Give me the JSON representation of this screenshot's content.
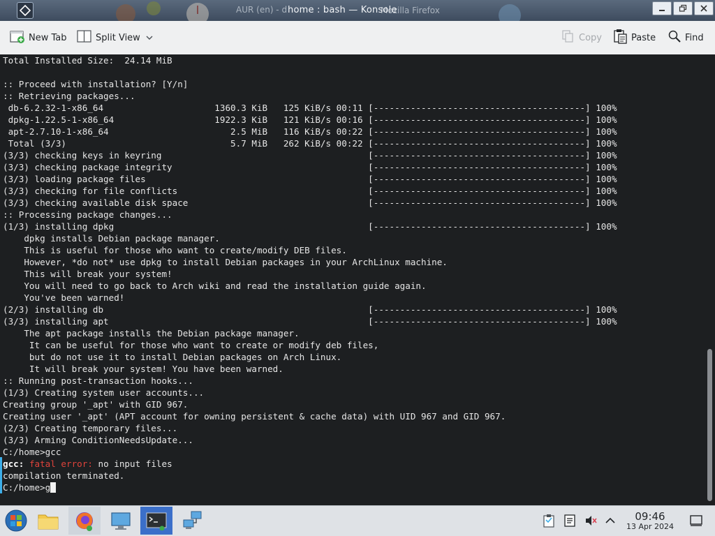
{
  "window": {
    "title": "home : bash — Konsole",
    "behind_title_left": "AUR (en) - d",
    "behind_title_right": "Mozilla Firefox"
  },
  "toolbar": {
    "new_tab": "New Tab",
    "split_view": "Split View",
    "copy": "Copy",
    "paste": "Paste",
    "find": "Find"
  },
  "terminal": {
    "lines": [
      "Total Installed Size:  24.14 MiB",
      "",
      ":: Proceed with installation? [Y/n]",
      ":: Retrieving packages...",
      " db-6.2.32-1-x86_64                     1360.3 KiB   125 KiB/s 00:11 [----------------------------------------] 100%",
      " dpkg-1.22.5-1-x86_64                   1922.3 KiB   121 KiB/s 00:16 [----------------------------------------] 100%",
      " apt-2.7.10-1-x86_64                       2.5 MiB   116 KiB/s 00:22 [----------------------------------------] 100%",
      " Total (3/3)                               5.7 MiB   262 KiB/s 00:22 [----------------------------------------] 100%",
      "(3/3) checking keys in keyring                                       [----------------------------------------] 100%",
      "(3/3) checking package integrity                                     [----------------------------------------] 100%",
      "(3/3) loading package files                                          [----------------------------------------] 100%",
      "(3/3) checking for file conflicts                                    [----------------------------------------] 100%",
      "(3/3) checking available disk space                                  [----------------------------------------] 100%",
      ":: Processing package changes...",
      "(1/3) installing dpkg                                                [----------------------------------------] 100%",
      "    dpkg installs Debian package manager.",
      "    This is useful for those who want to create/modify DEB files.",
      "    However, *do not* use dpkg to install Debian packages in your ArchLinux machine.",
      "    This will break your system!",
      "    You will need to go back to Arch wiki and read the installation guide again.",
      "    You've been warned!",
      "(2/3) installing db                                                  [----------------------------------------] 100%",
      "(3/3) installing apt                                                 [----------------------------------------] 100%",
      "    The apt package installs the Debian package manager.",
      "     It can be useful for those who want to create or modify deb files,",
      "     but do not use it to install Debian packages on Arch Linux.",
      "     It will break your system! You have been warned.",
      ":: Running post-transaction hooks...",
      "(1/3) Creating system user accounts...",
      "Creating group '_apt' with GID 967.",
      "Creating user '_apt' (APT account for owning persistent & cache data) with UID 967 and GID 967.",
      "(2/3) Creating temporary files...",
      "(3/3) Arming ConditionNeedsUpdate...",
      "C:/home>gcc"
    ],
    "error_prefix": "gcc:",
    "error_label": "fatal error:",
    "error_msg": " no input files",
    "after_error": "compilation terminated.",
    "prompt": "C:/home>g"
  },
  "clock": {
    "time": "09:46",
    "date": "13 Apr 2024"
  },
  "colors": {
    "terminal_bg": "#1d1f21",
    "terminal_fg": "#e6e6e6",
    "error": "#e0433b",
    "accent": "#3daee9",
    "taskbar_active": "#3b6fc9"
  }
}
